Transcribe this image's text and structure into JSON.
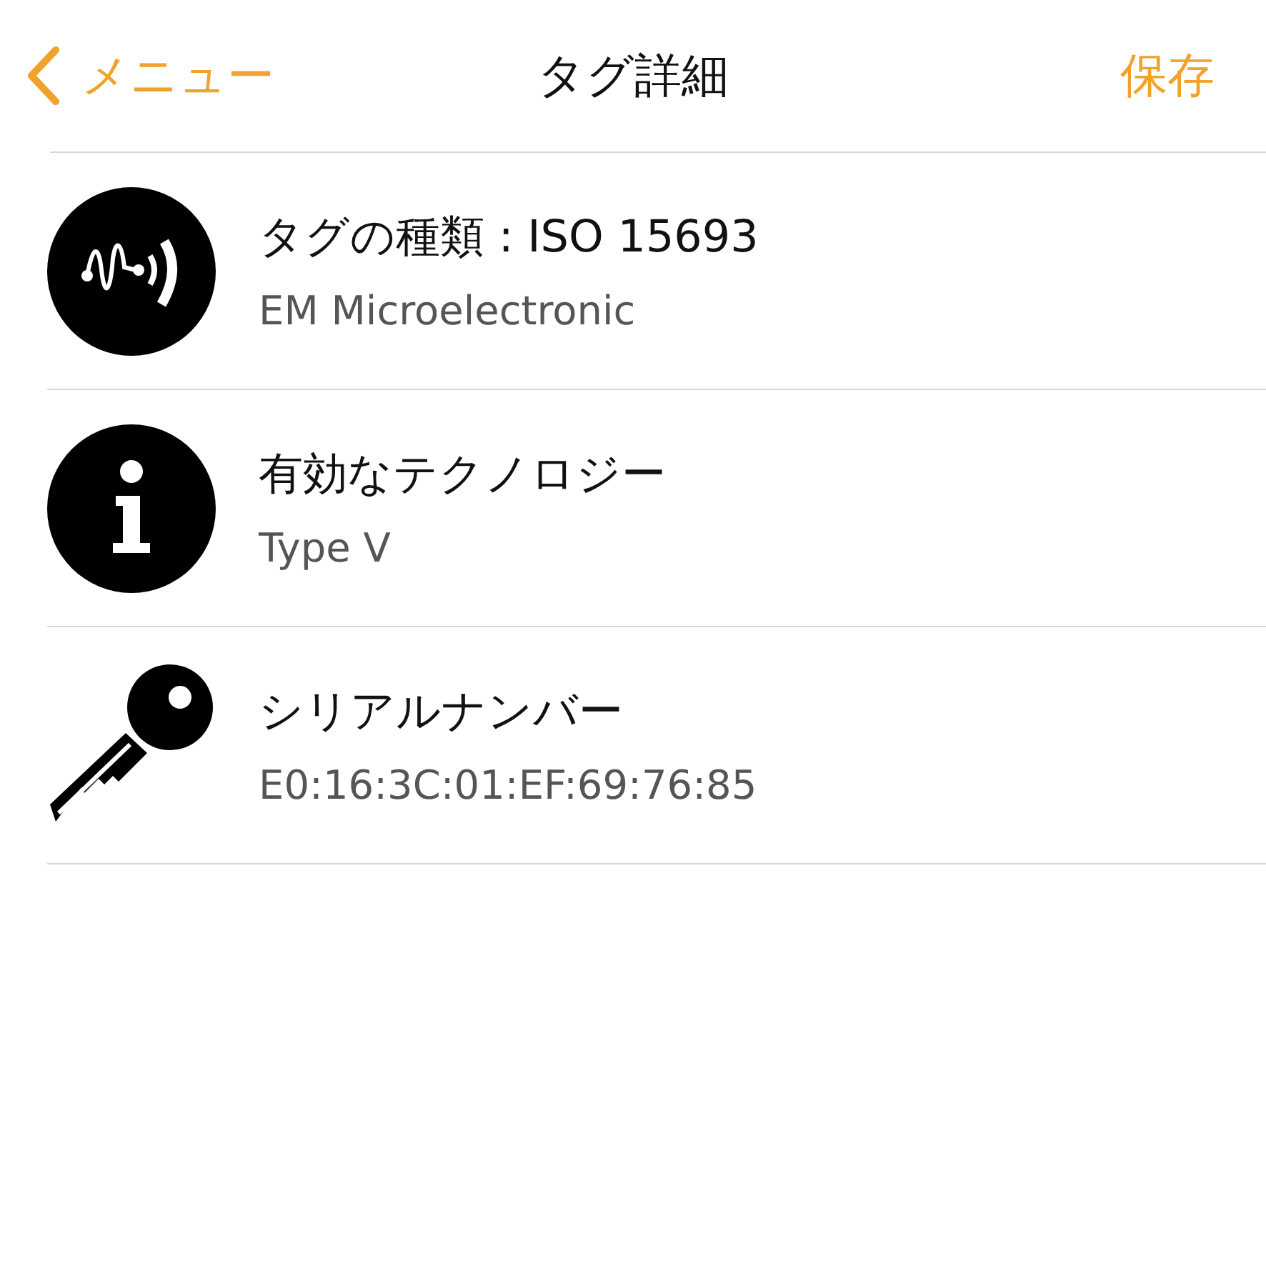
{
  "nav": {
    "back": "メニュー",
    "title": "タグ詳細",
    "action": "保存"
  },
  "rows": [
    {
      "kind": "nfc",
      "title": "タグの種類 : ISO 15693",
      "subtitle": "EM Microelectronic"
    },
    {
      "kind": "info",
      "title": "有効なテクノロジー",
      "subtitle": "Type V"
    },
    {
      "kind": "key",
      "title": "シリアルナンバー",
      "subtitle": "E0:16:3C:01:EF:69:76:85"
    }
  ]
}
